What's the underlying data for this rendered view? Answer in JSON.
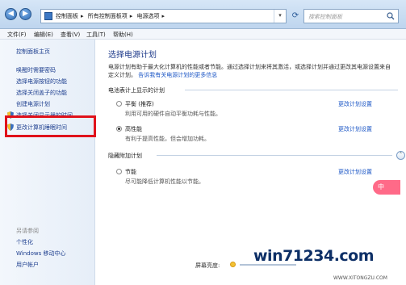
{
  "addressbar": {
    "crumbs": [
      "控制面板",
      "所有控制面板项",
      "电源选项"
    ],
    "search_placeholder": "搜索控制面板"
  },
  "menubar": {
    "items": [
      "文件(F)",
      "编辑(E)",
      "查看(V)",
      "工具(T)",
      "帮助(H)"
    ]
  },
  "sidebar": {
    "home": "控制面板主页",
    "items": [
      "唤醒时需要密码",
      "选择电源按钮的功能",
      "选择关闭盖子的功能",
      "创建电源计划",
      "选择关闭显示器的时间",
      "更改计算机睡眠时间"
    ],
    "see_also_title": "另请参阅",
    "see_also": [
      "个性化",
      "Windows 移动中心",
      "用户帐户"
    ]
  },
  "main": {
    "heading": "选择电源计划",
    "description": "电源计划有助于最大化计算机的性能或者节能。通过选择计划来将其激活，或选择计划并通过更改其电源设置来自定义计划。",
    "description_link": "告诉我有关电源计划的更多信息",
    "battery_section": "电池表计上显示的计划",
    "hidden_section": "隐藏附加计划",
    "plans": [
      {
        "name": "平衡 (推荐)",
        "desc": "利用可用的硬件自动平衡功耗与性能。",
        "link": "更改计划设置",
        "selected": false
      },
      {
        "name": "高性能",
        "desc": "有利于提高性能，但会增加功耗。",
        "link": "更改计划设置",
        "selected": true
      },
      {
        "name": "节能",
        "desc": "尽可能降低计算机性能以节能。",
        "link": "更改计划设置",
        "selected": false
      }
    ],
    "brightness_label": "屏幕亮度:"
  },
  "overlay": {
    "watermark": "win71234.com",
    "watermark_sub": "WWW.XITONGZU.COM",
    "badge": "中"
  }
}
